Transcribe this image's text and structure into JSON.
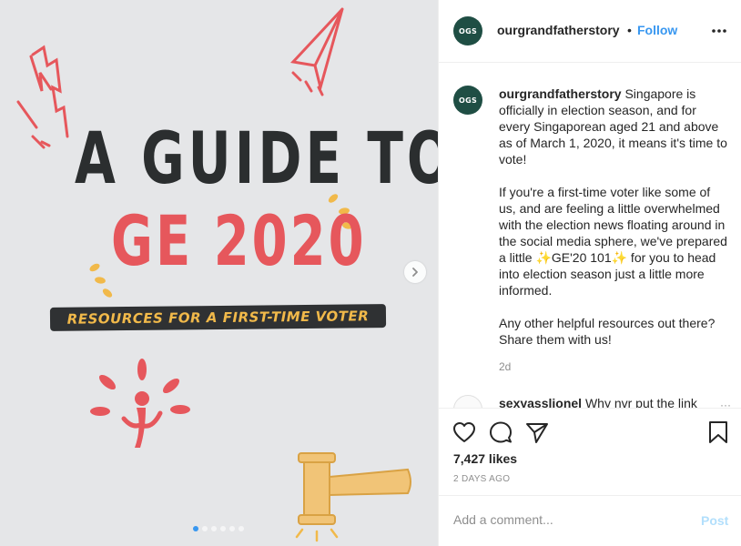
{
  "post_image": {
    "title_line1": "A GUIDE TO",
    "title_line2": "GE 2020",
    "banner_text": "RESOURCES FOR A FIRST-TIME VOTER",
    "carousel_dots": 6,
    "active_dot": 0,
    "colors": {
      "background": "#e5e6e8",
      "title": "#2b2e2f",
      "accent_red": "#e6575c",
      "accent_yellow": "#f1b94a"
    }
  },
  "header": {
    "avatar_text": "OGS",
    "username": "ourgrandfatherstory",
    "separator": "•",
    "follow_label": "Follow",
    "more_icon": "more-horizontal-icon"
  },
  "caption": {
    "avatar_text": "OGS",
    "username": "ourgrandfatherstory",
    "paragraph1": "Singapore is officially in election season, and for every Singaporean aged 21 and above as of March 1, 2020, it means it's time to vote!",
    "paragraph2": "If you're a first-time voter like some of us, and are feeling a little overwhelmed with the election news floating around in the social media sphere, we've prepared a little ✨GE'20 101✨ for you to head into election season just a little more informed.",
    "paragraph3": "Any other helpful resources out there? Share them with us!",
    "time": "2d"
  },
  "next_comment": {
    "username": "sexyasslionel",
    "text": "Why nvr put the link",
    "more": "···"
  },
  "actions": {
    "icons": [
      "heart-icon",
      "comment-icon",
      "share-icon",
      "bookmark-icon"
    ],
    "likes": "7,427 likes",
    "date": "2 DAYS AGO"
  },
  "add_comment": {
    "placeholder": "Add a comment...",
    "post_label": "Post"
  }
}
